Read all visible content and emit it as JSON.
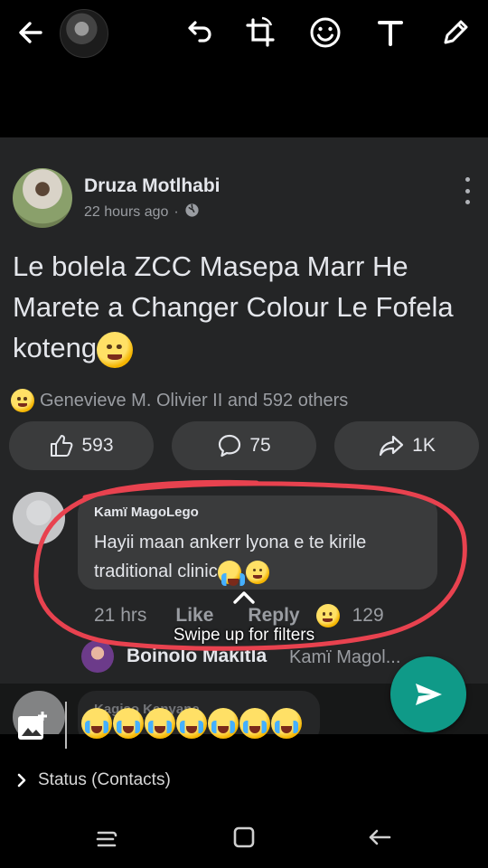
{
  "post": {
    "author": "Druza Motlhabi",
    "time": "22 hours ago",
    "separator": "·",
    "text": "Le bolela ZCC Masepa Marr He Marete a Changer Colour Le Fofela koteng",
    "reactions": "Genevieve M. Olivier II and 592 others",
    "likes": "593",
    "comments": "75",
    "shares": "1K"
  },
  "comment": {
    "author": "Kamï MagoLego",
    "text": "Hayii maan ankerr lyona e te kirile traditional clinic",
    "time": "21 hrs",
    "like_label": "Like",
    "reply_label": "Reply",
    "reaction_count": "129"
  },
  "reply": {
    "author": "Boinolo Makitla",
    "text": "Kamï Magol..."
  },
  "next_comment": {
    "author": "Kagiso Kenyane"
  },
  "overlay": {
    "swipe_hint": "Swipe up for filters",
    "status_label": "Status (Contacts)"
  },
  "colors": {
    "annotation": "#e8424f",
    "send_button": "#0f9a88",
    "card_bg": "#242526",
    "bubble_bg": "#3a3b3c"
  },
  "icons": {
    "toolbar": [
      "back-arrow-icon",
      "undo-icon",
      "crop-rotate-icon",
      "emoji-icon",
      "text-icon",
      "pencil-icon"
    ],
    "nav": [
      "recent-apps-icon",
      "home-icon",
      "back-icon"
    ]
  }
}
